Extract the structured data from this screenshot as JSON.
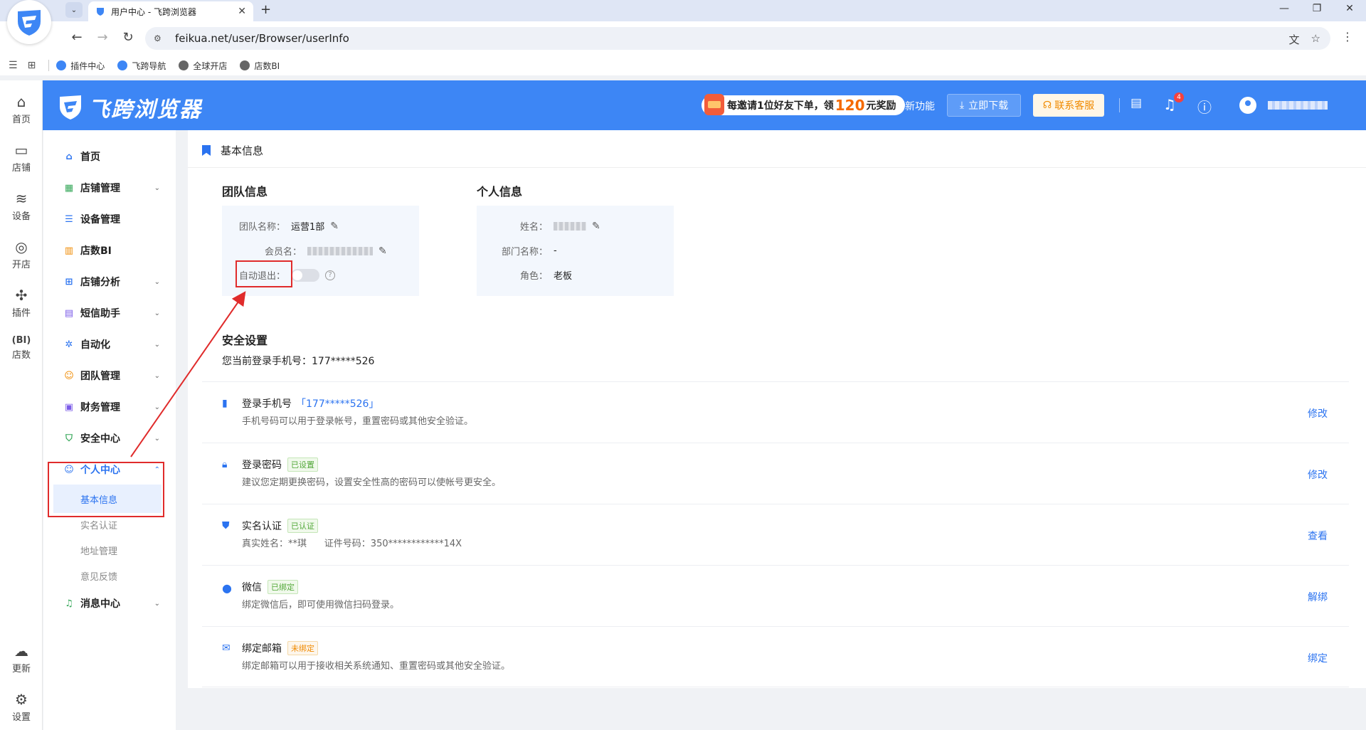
{
  "browser": {
    "tab_title": "用户中心 - 飞跨浏览器",
    "url": "feikua.net/user/Browser/userInfo",
    "bookmarks": [
      "插件中心",
      "飞跨导航",
      "全球开店",
      "店数BI"
    ]
  },
  "header": {
    "brand": "飞跨浏览器",
    "invite_pre": "每邀请1位好友下单，领",
    "invite_num": "120",
    "invite_post": "元奖励",
    "new_feature": "新功能",
    "download": "立即下载",
    "contact": "联系客服",
    "notif_count": "4"
  },
  "rail": [
    "首页",
    "店铺",
    "设备",
    "开店",
    "插件",
    "店数",
    "更新",
    "设置"
  ],
  "sidenav": {
    "items": [
      "首页",
      "店铺管理",
      "设备管理",
      "店数BI",
      "店铺分析",
      "短信助手",
      "自动化",
      "团队管理",
      "财务管理",
      "安全中心",
      "个人中心",
      "消息中心"
    ],
    "sub_items": [
      "基本信息",
      "实名认证",
      "地址管理",
      "意见反馈"
    ]
  },
  "main": {
    "breadcrumb": "基本信息",
    "team": {
      "title": "团队信息",
      "name_label": "团队名称：",
      "name_value": "运营1部",
      "member_label": "会员名：",
      "auto_logout_label": "自动退出："
    },
    "personal": {
      "title": "个人信息",
      "name_label": "姓名：",
      "dept_label": "部门名称：",
      "dept_value": "-",
      "role_label": "角色：",
      "role_value": "老板"
    },
    "security": {
      "title": "安全设置",
      "current_phone": "您当前登录手机号：177*****526",
      "rows": [
        {
          "title": "登录手机号",
          "extra": "「177*****526」",
          "desc": "手机号码可以用于登录帐号，重置密码或其他安全验证。",
          "action": "修改"
        },
        {
          "title": "登录密码",
          "tag": "已设置",
          "desc": "建议您定期更换密码，设置安全性高的密码可以使帐号更安全。",
          "action": "修改"
        },
        {
          "title": "实名认证",
          "tag": "已认证",
          "desc": "真实姓名：**琪      证件号码：350************14X",
          "action": "查看"
        },
        {
          "title": "微信",
          "tag": "已绑定",
          "desc": "绑定微信后，即可使用微信扫码登录。",
          "action": "解绑"
        },
        {
          "title": "绑定邮箱",
          "tag": "未绑定",
          "desc": "绑定邮箱可以用于接收相关系统通知、重置密码或其他安全验证。",
          "action": "绑定"
        }
      ]
    }
  },
  "colors": {
    "primary": "#3d86f5",
    "link": "#2b73f0",
    "annotation": "#e02b2b"
  }
}
